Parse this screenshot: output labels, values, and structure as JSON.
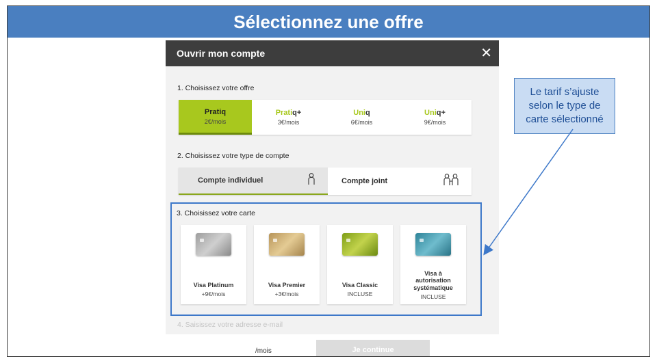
{
  "banner": {
    "title": "Sélectionnez une offre"
  },
  "modal": {
    "title": "Ouvrir mon compte",
    "close_icon": "close-icon",
    "step1": {
      "label": "1. Choisissez votre offre",
      "offers": [
        {
          "base": "Pratiq",
          "accent": "",
          "price": "2€/mois",
          "selected": true
        },
        {
          "base": "Prati",
          "accent": "q+",
          "price": "3€/mois",
          "selected": false
        },
        {
          "base": "Uni",
          "accent": "q",
          "price": "6€/mois",
          "selected": false
        },
        {
          "base": "Uni",
          "accent": "q+",
          "price": "9€/mois",
          "selected": false
        }
      ]
    },
    "step2": {
      "label": "2. Choisissez votre type de compte",
      "accounts": [
        {
          "label": "Compte individuel",
          "icon": "person-icon",
          "selected": true
        },
        {
          "label": "Compte joint",
          "icon": "two-persons-icon",
          "selected": false
        }
      ]
    },
    "step3": {
      "label": "3. Choisissez votre carte",
      "cards": [
        {
          "name": "Visa Platinum",
          "price": "+9€/mois",
          "image": "platinum"
        },
        {
          "name": "Visa Premier",
          "price": "+3€/mois",
          "image": "premier"
        },
        {
          "name": "Visa Classic",
          "price": "INCLUSE",
          "image": "classic"
        },
        {
          "name": "Visa à autorisation systématique",
          "price": "INCLUSE",
          "image": "systematic"
        }
      ]
    },
    "step4": {
      "label": "4. Saisissez votre adresse e-mail"
    },
    "footer": {
      "per_month": "/mois",
      "continue_label": "Je continue"
    }
  },
  "callout": {
    "text": "Le tarif s’ajuste selon le type de carte sélectionné"
  },
  "colors": {
    "banner": "#4a7fc0",
    "accent_green": "#a8c81e",
    "highlight_blue": "#3d78c9",
    "callout_bg": "#c9dcf3"
  }
}
